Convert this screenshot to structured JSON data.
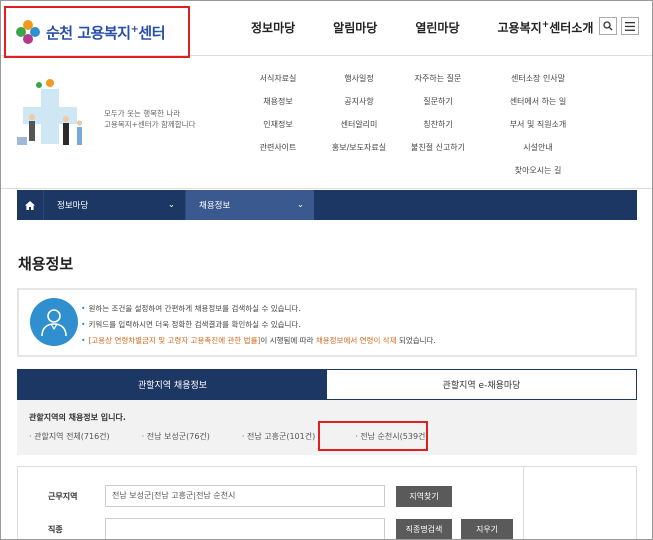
{
  "header": {
    "logo_text": "순천 고용복지",
    "logo_sup": "+",
    "logo_suffix": "센터",
    "nav": [
      {
        "label": "정보마당"
      },
      {
        "label": "알림마당"
      },
      {
        "label": "열린마당"
      },
      {
        "label": "고용복지",
        "sup": "+",
        "suffix": "센터소개"
      }
    ],
    "search_icon": "search-icon",
    "menu_icon": "hamburger-menu-icon"
  },
  "mega": {
    "intro_line1": "모두가 웃는 행복한 나라",
    "intro_line2": "고용복지+센터가 함께합니다",
    "columns": [
      [
        "서식자료실",
        "채용정보",
        "인재정보",
        "관련사이트"
      ],
      [
        "행사일정",
        "공지사항",
        "센터알리미",
        "홍보/보도자료실"
      ],
      [
        "자주하는 질문",
        "질문하기",
        "칭찬하기",
        "불친절 신고하기"
      ],
      [
        "센터소장 인사말",
        "센터에서 하는 일",
        "부서 및 직원소개",
        "시설안내",
        "찾아오시는 길"
      ]
    ]
  },
  "locbar": {
    "home_icon": "home-icon",
    "item1": "정보마당",
    "item2": "채용정보",
    "chevron": "⌄"
  },
  "page_title": "채용정보",
  "info": {
    "line1": "원하는 조건을 설정하여 간편하게 채용정보를 검색하실 수 있습니다.",
    "line2": "키워드를 입력하시면 더욱 정확한 검색결과를 확인하실 수 있습니다.",
    "line3_link": "[고용상 연령차별금지 및 고령자 고용촉진에 관한 법률]",
    "line3_mid": "이 시행됨에 따라 ",
    "line3_em": "채용정보에서 연령이 삭제",
    "line3_end": " 되었습니다."
  },
  "tabs": {
    "tab1": "관할지역 채용정보",
    "tab2": "관할지역 e-채용마당"
  },
  "region": {
    "title": "관할지역의 채용정보 입니다.",
    "items": [
      "관할지역 전체(716건)",
      "전남 보성군(76건)",
      "전남 고흥군(101건)",
      "전남 순천시(539건)"
    ]
  },
  "form": {
    "work_label": "근무지역",
    "work_value": "전남 보성군|전남 고흥군|전남 순천시",
    "region_btn": "지역찾기",
    "job_label": "직종",
    "job_value": "",
    "job_btn": "직종명검색",
    "clear_btn": "지우기"
  },
  "colors": {
    "navy": "#1c3764",
    "accent_blue": "#2f8fcf",
    "highlight_red": "#e02020",
    "orange": "#d26a1f"
  }
}
